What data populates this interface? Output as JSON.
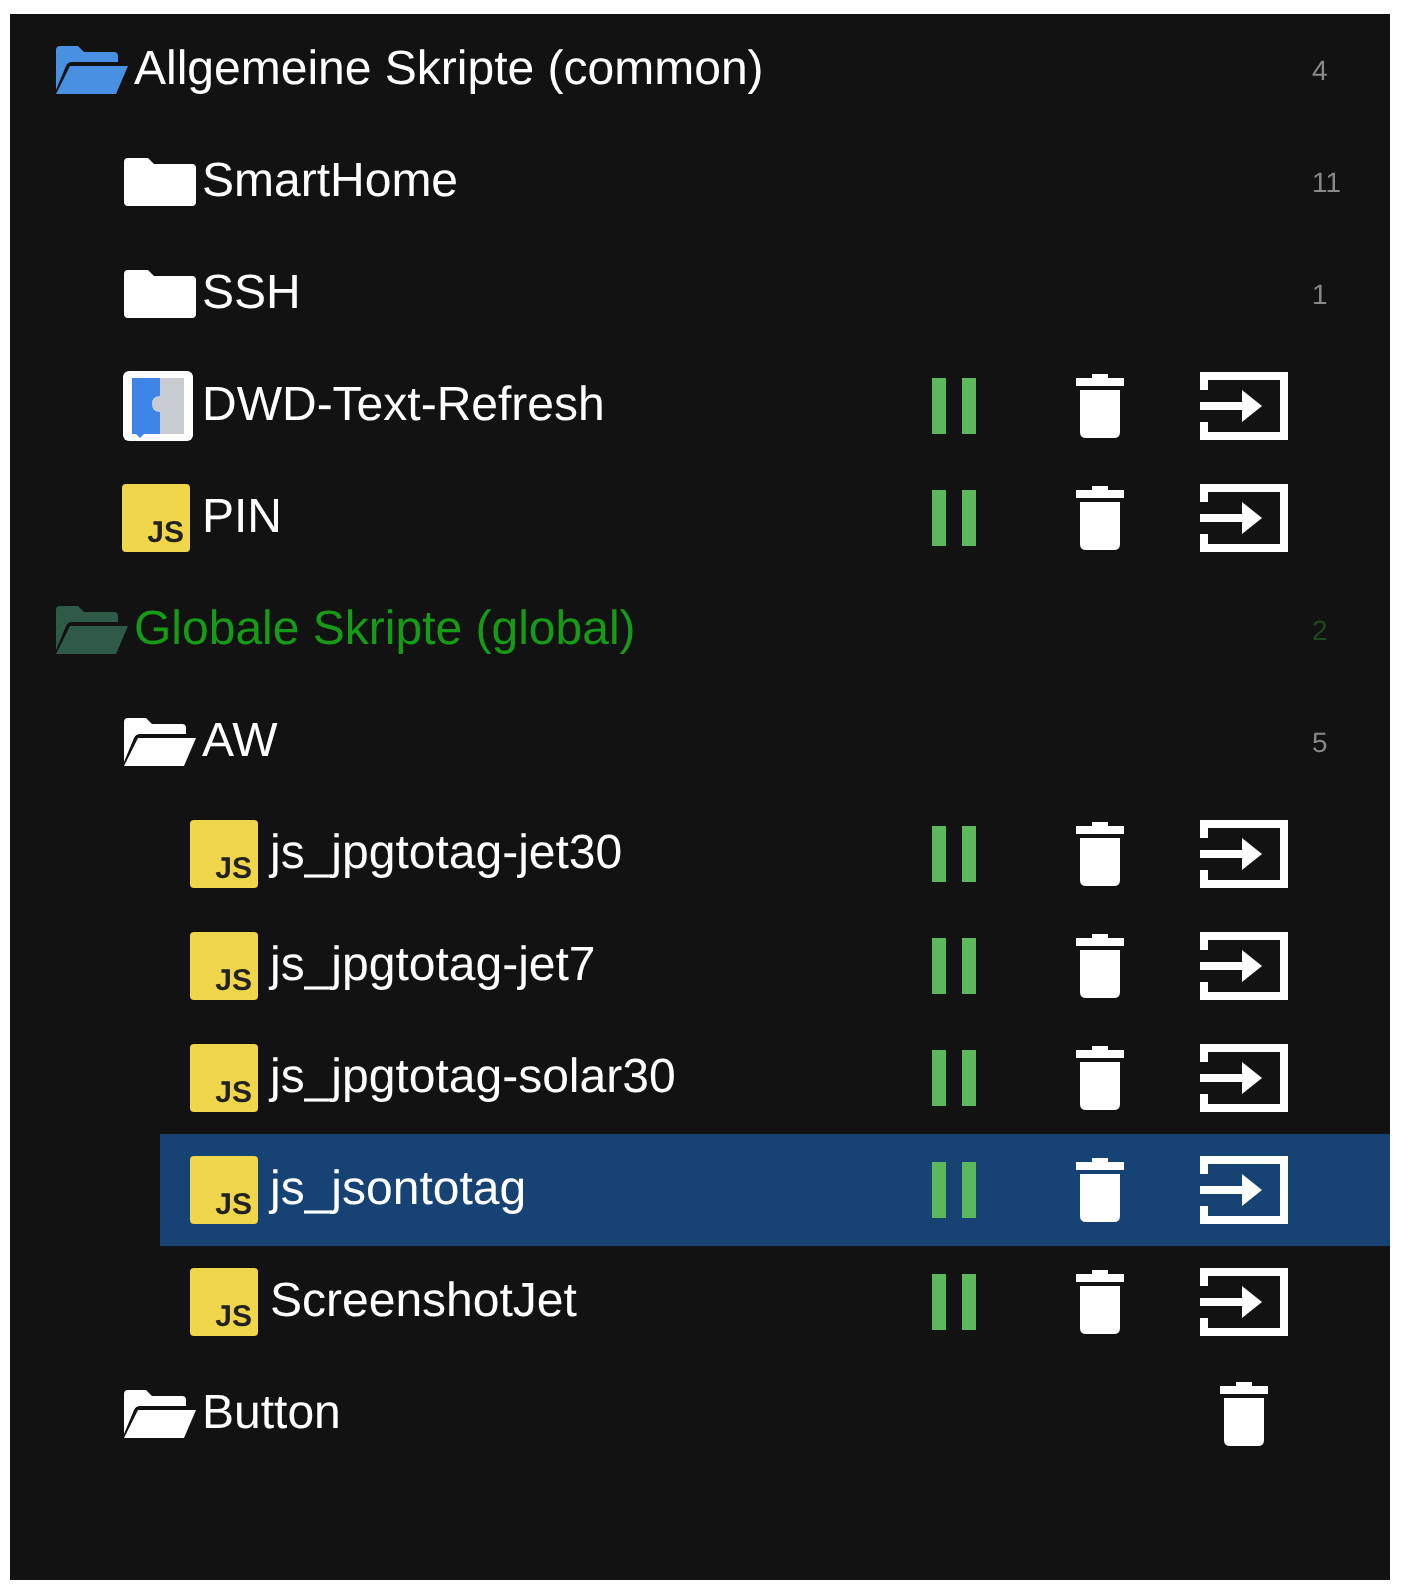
{
  "tree": [
    {
      "kind": "folder",
      "color": "#4a90e2",
      "highlighted": false,
      "label": "Allgemeine Skripte (common)",
      "count": "4",
      "expanded": true,
      "selected": false,
      "deletable": false,
      "children": [
        {
          "kind": "folder",
          "label": "SmartHome",
          "count": "11",
          "expanded": false,
          "selected": false,
          "deletable": false
        },
        {
          "kind": "folder",
          "label": "SSH",
          "count": "1",
          "expanded": false,
          "selected": false,
          "deletable": false
        },
        {
          "kind": "blockly",
          "label": "DWD-Text-Refresh",
          "running": true,
          "selected": false
        },
        {
          "kind": "js",
          "badge": "JS",
          "label": "PIN",
          "running": true,
          "selected": false
        }
      ]
    },
    {
      "kind": "folder",
      "color": "#2f5a48",
      "highlighted": true,
      "label": "Globale Skripte (global)",
      "count": "2",
      "expanded": true,
      "selected": false,
      "deletable": false,
      "children": [
        {
          "kind": "folder",
          "label": "AW",
          "count": "5",
          "expanded": true,
          "selected": false,
          "deletable": false,
          "children": [
            {
              "kind": "js",
              "badge": "JS",
              "label": "js_jpgtotag-jet30",
              "running": true,
              "selected": false
            },
            {
              "kind": "js",
              "badge": "JS",
              "label": "js_jpgtotag-jet7",
              "running": true,
              "selected": false
            },
            {
              "kind": "js",
              "badge": "JS",
              "label": "js_jpgtotag-solar30",
              "running": true,
              "selected": false
            },
            {
              "kind": "js",
              "badge": "JS",
              "label": "js_jsontotag",
              "running": true,
              "selected": true
            },
            {
              "kind": "js",
              "badge": "JS",
              "label": "ScreenshotJet",
              "running": true,
              "selected": false
            }
          ]
        },
        {
          "kind": "folder",
          "label": "Button",
          "expanded": true,
          "selected": false,
          "deletable": true
        }
      ]
    }
  ]
}
